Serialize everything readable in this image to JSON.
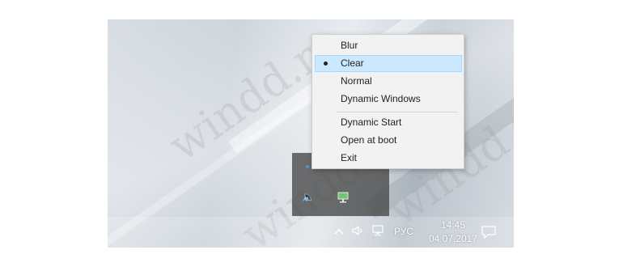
{
  "context_menu": {
    "items": [
      {
        "label": "Blur",
        "checked": false
      },
      {
        "label": "Clear",
        "checked": true
      },
      {
        "label": "Normal",
        "checked": false
      },
      {
        "label": "Dynamic Windows",
        "checked": false
      },
      {
        "label": "Dynamic Start",
        "checked": false
      },
      {
        "label": "Open at boot",
        "checked": false
      },
      {
        "label": "Exit",
        "checked": false
      }
    ]
  },
  "taskbar": {
    "language": "РУС",
    "time": "14:45",
    "date": "04.07.2017"
  },
  "icons": {
    "tray_up": "chevron-up-icon",
    "volume": "speaker-icon",
    "network": "network-icon",
    "notifications": "action-center-icon"
  },
  "colors": {
    "selection": "#cce8ff",
    "menu_bg": "#f2f2f2"
  }
}
